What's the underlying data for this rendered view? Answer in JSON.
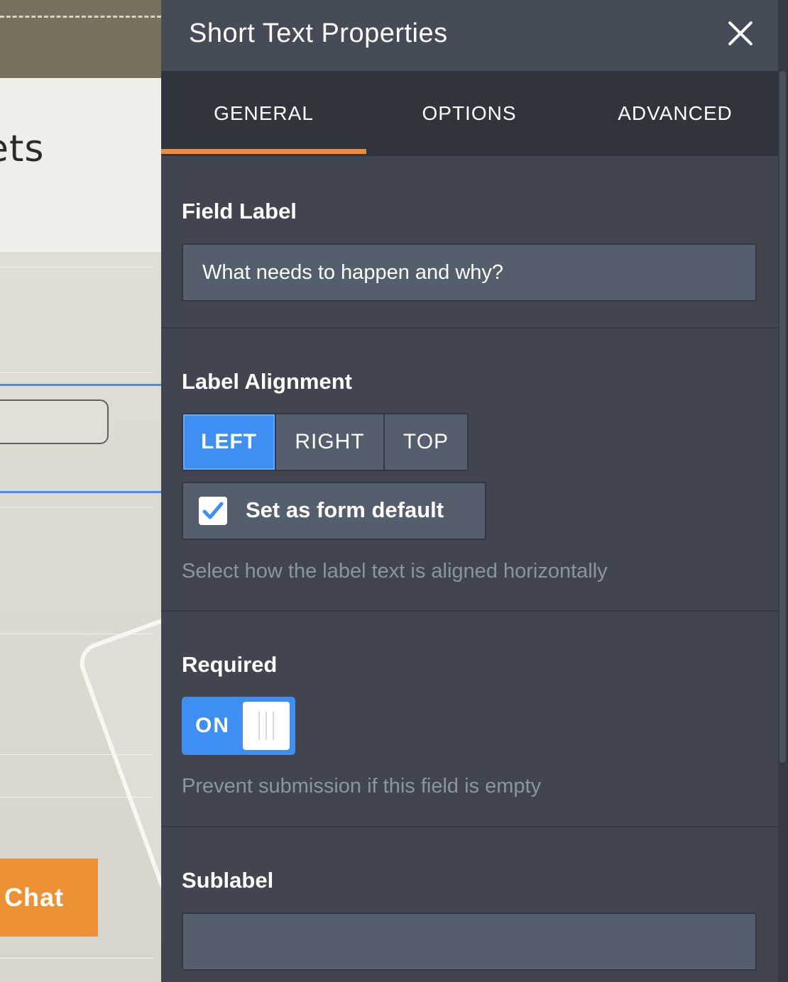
{
  "background": {
    "header_text": "ets",
    "chat_button_label": "Chat"
  },
  "panel": {
    "title": "Short Text Properties",
    "tabs": [
      {
        "label": "GENERAL",
        "active": true
      },
      {
        "label": "OPTIONS",
        "active": false
      },
      {
        "label": "ADVANCED",
        "active": false
      }
    ],
    "field_label": {
      "title": "Field Label",
      "value": "What needs to happen and why?"
    },
    "label_alignment": {
      "title": "Label Alignment",
      "options": [
        "LEFT",
        "RIGHT",
        "TOP"
      ],
      "selected": "LEFT",
      "default_checkbox_label": "Set as form default",
      "default_checked": true,
      "hint": "Select how the label text is aligned horizontally"
    },
    "required": {
      "title": "Required",
      "toggle_label": "ON",
      "enabled": true,
      "hint": "Prevent submission if this field is empty"
    },
    "sublabel": {
      "title": "Sublabel",
      "value": ""
    }
  },
  "colors": {
    "accent_orange": "#f08a3c",
    "toggle_blue": "#3f8ef1",
    "panel_bg": "#404550",
    "chat_orange": "#ec9234"
  },
  "icons": [
    "close-icon",
    "checkmark-icon"
  ]
}
